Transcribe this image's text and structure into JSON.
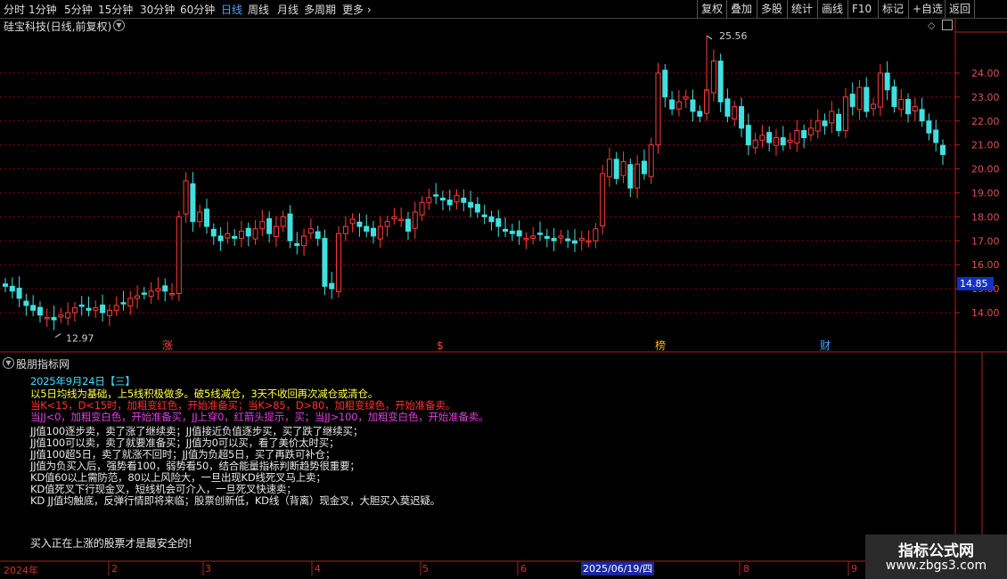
{
  "toolbar": {
    "periods": [
      "分时",
      "1分钟",
      "5分钟",
      "15分钟",
      "30分钟",
      "60分钟",
      "日线",
      "周线",
      "月线",
      "多周期",
      "更多 ›"
    ],
    "active_period": "日线",
    "right_buttons": [
      "复权",
      "叠加",
      "多股",
      "统计",
      "画线",
      "F10",
      "标记",
      "+自选",
      "返回"
    ]
  },
  "chart": {
    "title": "硅宝科技(日线,前复权)",
    "y_ticks": [
      "24.00",
      "23.00",
      "22.00",
      "21.00",
      "20.00",
      "19.00",
      "18.00",
      "17.00",
      "16.00",
      "15.00",
      "14.00"
    ],
    "current_price": "14.85",
    "high_label": "25.56",
    "low_label": "12.97",
    "event_markers": [
      {
        "label": "涨",
        "color": "#ff4040"
      },
      {
        "label": "$",
        "color": "#ff4040"
      },
      {
        "label": "榜",
        "color": "#ffb000"
      },
      {
        "label": "财",
        "color": "#4aa3ff"
      }
    ]
  },
  "indicator": {
    "name": "股朋指标网",
    "date_line": "2025年9月24日【三】",
    "line1": "以5日均线为基础，上5线积极做多。破5线减仓，3天不收回再次减仓或清仓。",
    "line2": "当K<15，D<15时，加粗变红色，开始准备买；当K>85，D>80，加粗变绿色，开始准备卖。",
    "line3": "当JJ<0，加粗变白色，开始准备买，JJ上穿0，红箭头提示，买；当JJ>100，加粗变白色，开始准备卖。",
    "rules": [
      "JJ值100逐步卖，卖了涨了继续卖；JJ值接近负值逐步买，买了跌了继续买；",
      "JJ值100可以卖，卖了就要准备买；JJ值为0可以买，看了美价太时买；",
      "JJ值100超5日，卖了就涨不回时；JJ值为负超5日，买了再跌可补仓；",
      "JJ值为负买入后，强势看100，弱势看50，结合能量指标判断趋势很重要；",
      "KD值60以上需防范，80以上风险大，一旦出现KD线死叉马上卖；",
      "KD值死叉下行现金叉，短线机会可介入，一旦死叉快速卖；",
      "KD JJ值均触底，反弹行情即将来临；股票创新低，KD线（背离）现金叉，大胆买入莫迟疑。"
    ],
    "footer": "买入正在上涨的股票才是最安全的!"
  },
  "date_axis": {
    "labels": [
      "2024年",
      "2",
      "3",
      "4",
      "5",
      "6",
      "8",
      "9"
    ],
    "cursor_date": "2025/06/19/四"
  },
  "watermark": {
    "line1": "指标公式网",
    "line2": "www.zbgs3.com"
  },
  "colors": {
    "up": "#ff3c3c",
    "down": "#40e0e0",
    "grid": "#8b0000",
    "yellow": "#ffff40",
    "red": "#ff3030",
    "magenta": "#e040e0",
    "cyan": "#40e0ff",
    "white": "#e8e8e8"
  }
}
